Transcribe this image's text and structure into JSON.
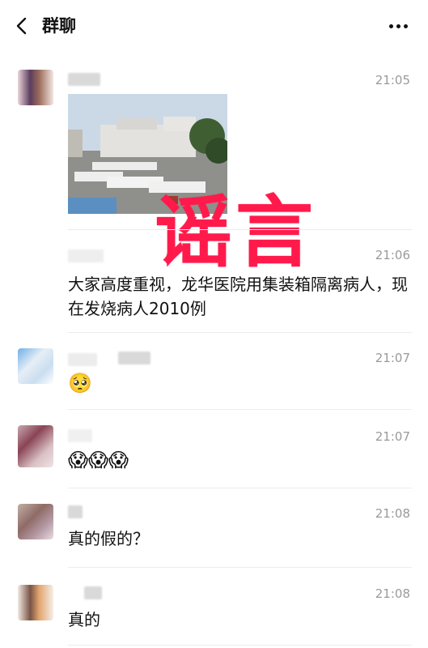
{
  "header": {
    "title": "群聊"
  },
  "stamp": {
    "text": "谣言"
  },
  "messages": [
    {
      "time": "21:05",
      "type": "image"
    },
    {
      "time": "21:06",
      "text": "大家高度重视，龙华医院用集装箱隔离病人，现在发烧病人2010例"
    },
    {
      "time": "21:07",
      "emoji": "🥺"
    },
    {
      "time": "21:07",
      "emoji": "😱😱😱"
    },
    {
      "time": "21:08",
      "text": "真的假的？"
    },
    {
      "time": "21:08",
      "text": "真的"
    }
  ],
  "colors": {
    "stamp": "#ff1a4b",
    "time": "#9a9a9a",
    "separator": "#ececec"
  }
}
